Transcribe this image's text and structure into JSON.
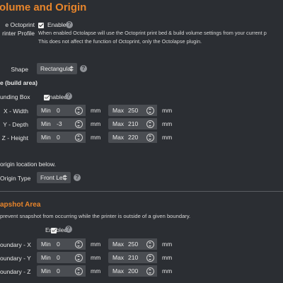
{
  "section1": {
    "title": "olume and Origin",
    "use_printer_profile": {
      "label_line1": "e Octoprint",
      "label_line2": "rinter Profile",
      "checkbox_label": "Enabled",
      "help_line1": "When enabled Octolapse will use the Octoprint print bed & build volume settings from your current p",
      "help_line2": "This does not affect the function of Octoprint, only the Octolapse plugin."
    },
    "shape": {
      "label": "Shape",
      "value": "Rectangular"
    },
    "build_area_heading": "e (build area)",
    "bounding_box": {
      "label": "unding Box",
      "checkbox_label": "Enabled"
    },
    "axes": [
      {
        "label": "X - Width",
        "min_prefix": "Min",
        "min_value": "0",
        "max_prefix": "Max",
        "max_value": "250",
        "unit": "mm"
      },
      {
        "label": "Y - Depth",
        "min_prefix": "Min",
        "min_value": "-3",
        "max_prefix": "Max",
        "max_value": "210",
        "unit": "mm"
      },
      {
        "label": "Z - Height",
        "min_prefix": "Min",
        "min_value": "0",
        "max_prefix": "Max",
        "max_value": "220",
        "unit": "mm"
      }
    ],
    "origin_note": "origin location below.",
    "origin_type": {
      "label": "Origin Type",
      "value": "Front Left"
    }
  },
  "section2": {
    "title": "apshot Area",
    "help": "prevent snapshot from occurring while the printer is outside of a given boundary.",
    "checkbox_label": "Enabled",
    "axes": [
      {
        "label": "oundary - X",
        "min_prefix": "Min",
        "min_value": "0",
        "max_prefix": "Max",
        "max_value": "250",
        "unit": "mm"
      },
      {
        "label": "oundary - Y",
        "min_prefix": "Min",
        "min_value": "0",
        "max_prefix": "Max",
        "max_value": "210",
        "unit": "mm"
      },
      {
        "label": "oundary - Z",
        "min_prefix": "Min",
        "min_value": "0",
        "max_prefix": "Max",
        "max_value": "200",
        "unit": "mm"
      }
    ]
  },
  "colors": {
    "background": "#2b2e33",
    "accent": "#e8852b",
    "input_bg": "#4a4d52"
  }
}
